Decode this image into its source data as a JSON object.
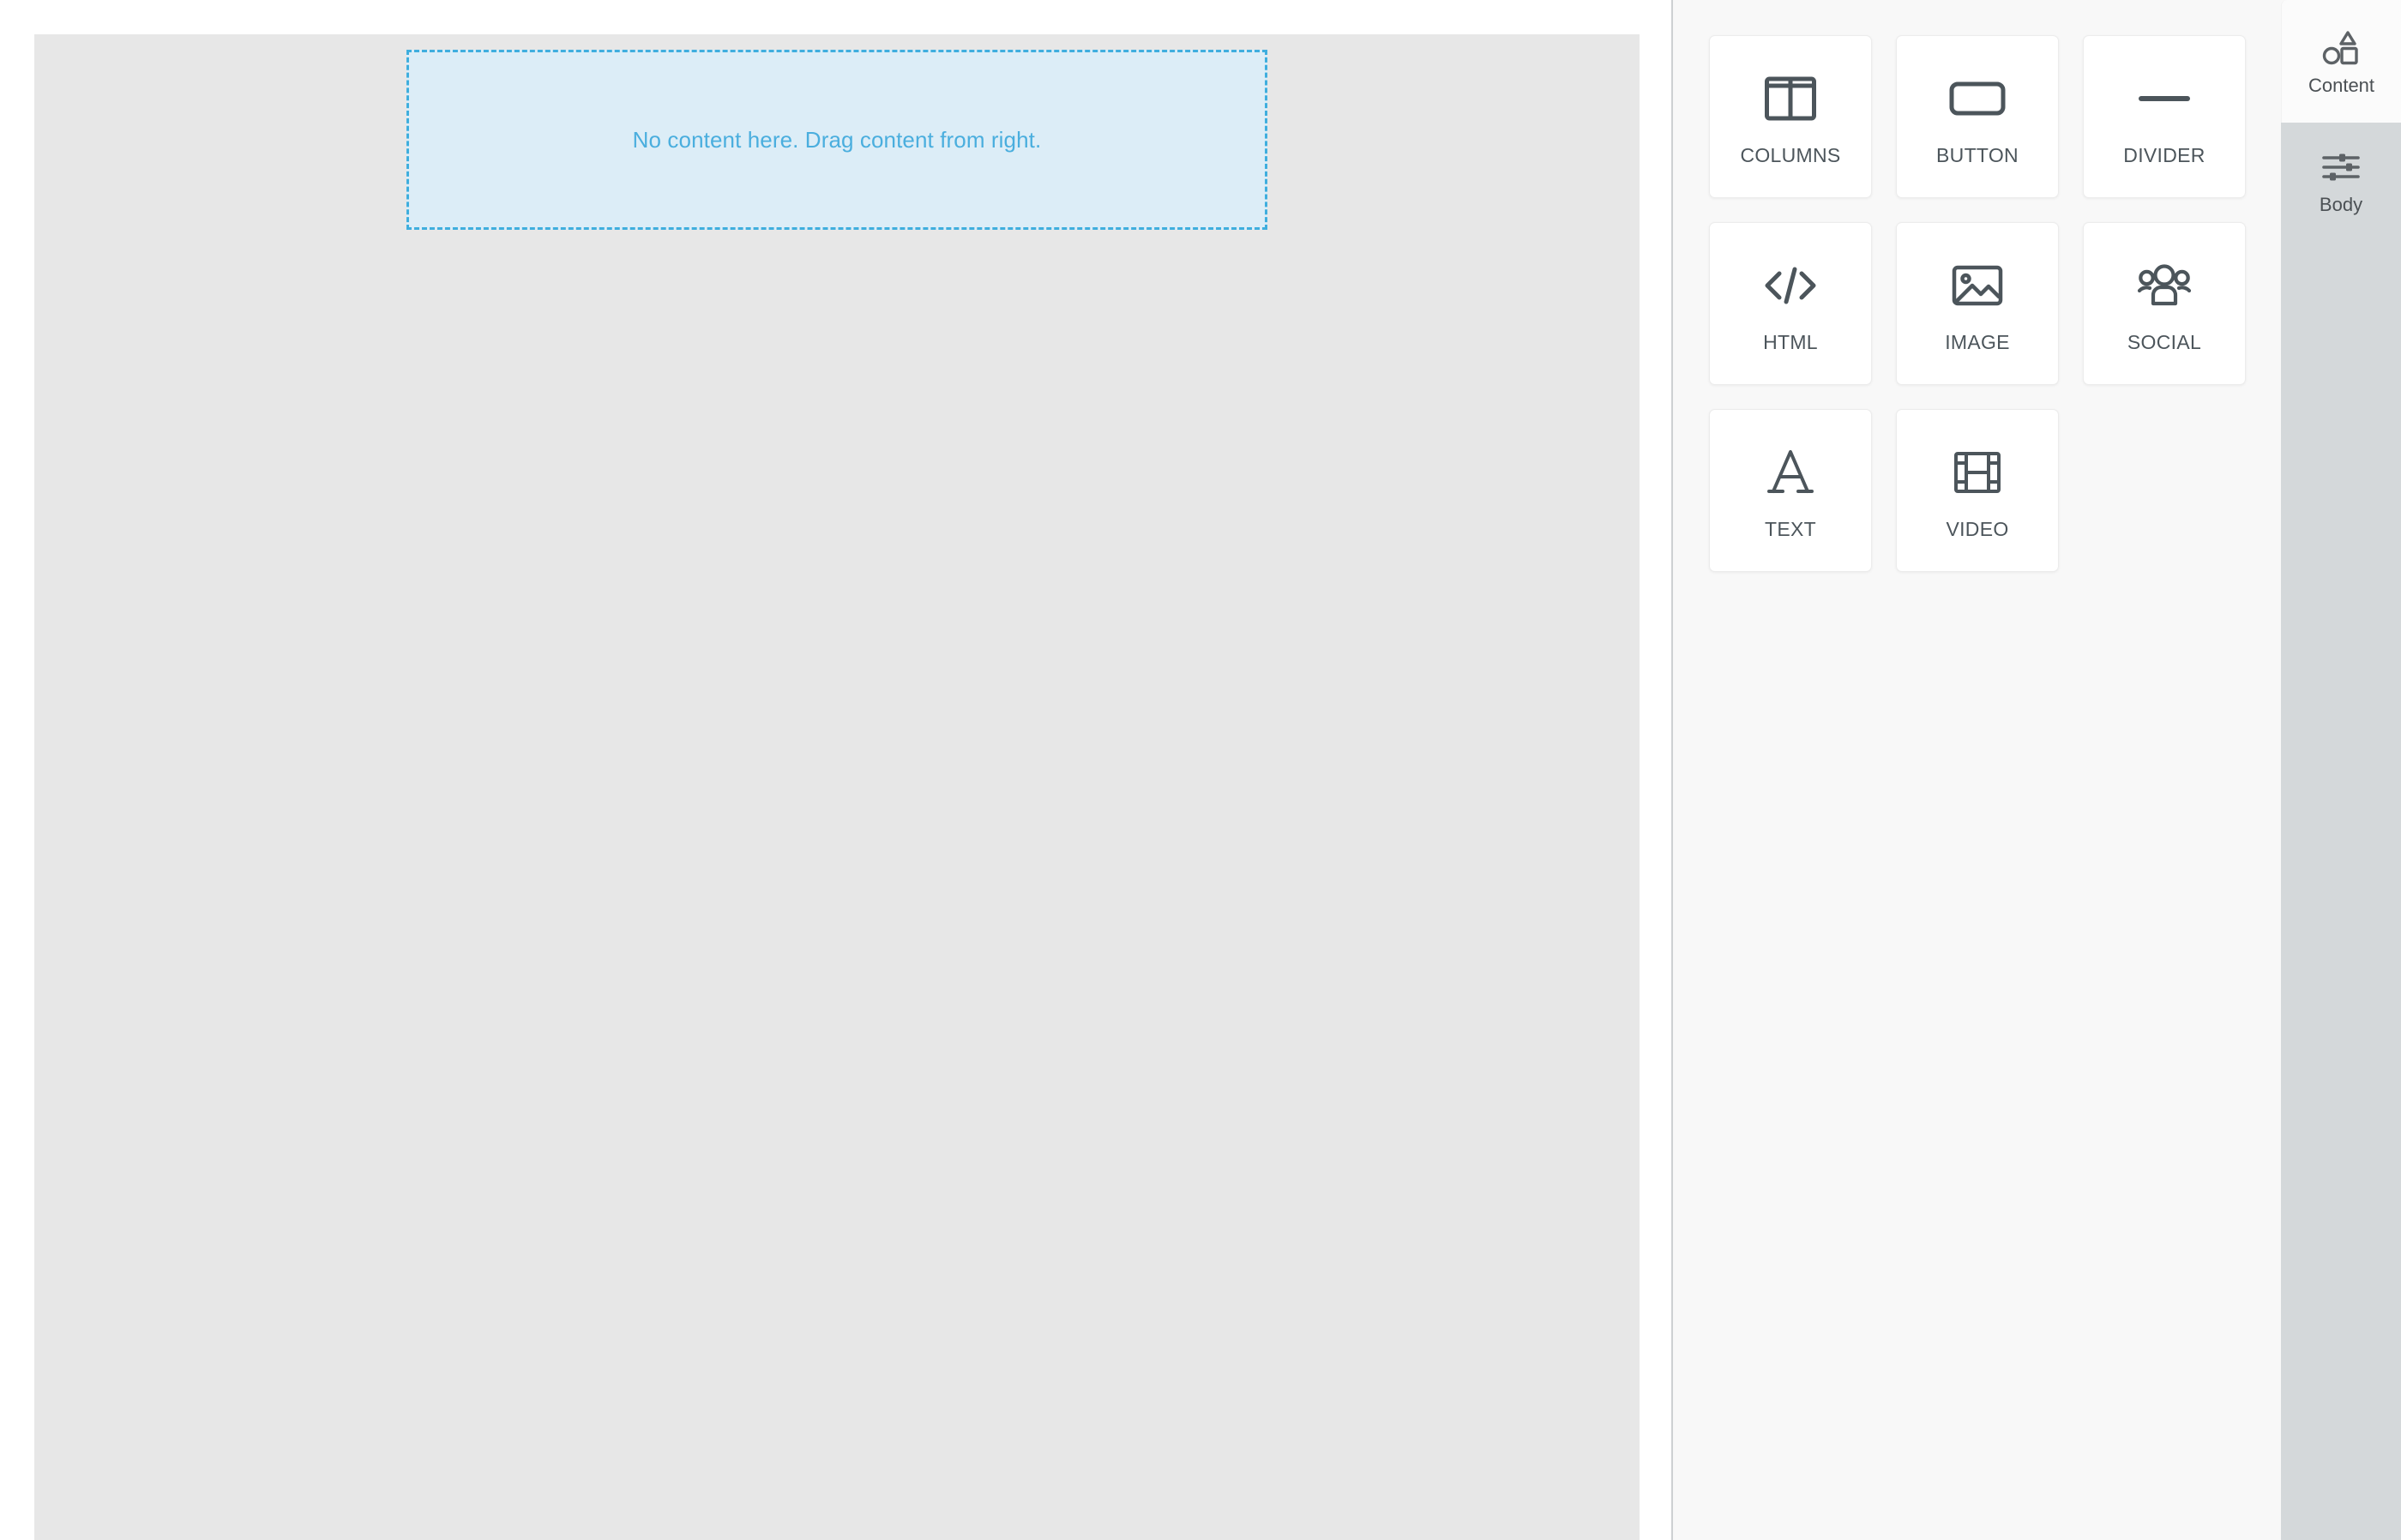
{
  "canvas": {
    "dropzone": {
      "message": "No content here. Drag content from right.",
      "fill_color": "#dcedf7",
      "border_color": "#3faede",
      "text_color": "#4aaede"
    },
    "background_color": "#e7e7e7"
  },
  "content_panel": {
    "background_color": "#f8f8f8",
    "tiles": [
      {
        "label": "COLUMNS",
        "icon": "columns-icon"
      },
      {
        "label": "BUTTON",
        "icon": "button-icon"
      },
      {
        "label": "DIVIDER",
        "icon": "divider-icon"
      },
      {
        "label": "HTML",
        "icon": "code-icon"
      },
      {
        "label": "IMAGE",
        "icon": "image-icon"
      },
      {
        "label": "SOCIAL",
        "icon": "people-icon"
      },
      {
        "label": "TEXT",
        "icon": "letter-a-icon"
      },
      {
        "label": "VIDEO",
        "icon": "film-icon"
      }
    ]
  },
  "tab_rail": {
    "tabs": [
      {
        "label": "Content",
        "icon": "shapes-icon",
        "active": false,
        "background_color": "#fbfbfb"
      },
      {
        "label": "Body",
        "icon": "sliders-icon",
        "active": true,
        "background_color": "#d4d8da"
      }
    ]
  }
}
